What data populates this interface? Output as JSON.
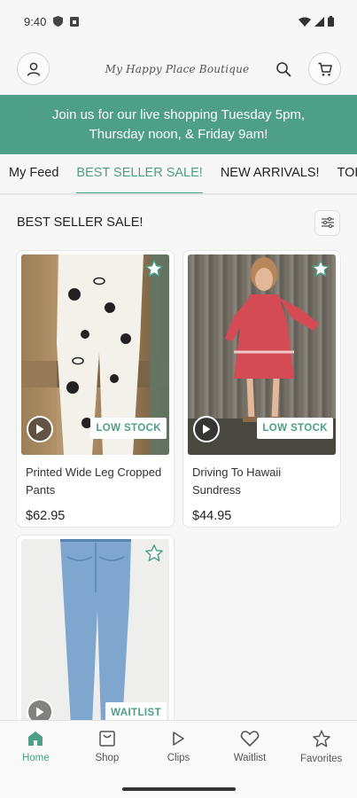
{
  "status": {
    "time": "9:40"
  },
  "header": {
    "brand": "My Happy Place Boutique"
  },
  "promo": {
    "text": "Join us for our live shopping Tuesday 5pm,\nThursday noon, & Friday 9am!"
  },
  "tabs": [
    {
      "label": "My Feed",
      "active": false
    },
    {
      "label": "BEST SELLER SALE!",
      "active": true
    },
    {
      "label": "NEW ARRIVALS!",
      "active": false
    },
    {
      "label": "TOPS",
      "active": false
    }
  ],
  "section": {
    "title": "BEST SELLER SALE!"
  },
  "products": [
    {
      "name": "Printed Wide Leg Cropped Pants",
      "price": "$62.95",
      "badge": "LOW STOCK",
      "image": "pants-photo"
    },
    {
      "name": "Driving To Hawaii Sundress",
      "price": "$44.95",
      "badge": "LOW STOCK",
      "image": "dress-photo"
    },
    {
      "name": "",
      "price": "",
      "badge": "WAITLIST",
      "image": "jeans-photo"
    }
  ],
  "nav": [
    {
      "label": "Home",
      "icon": "home-icon",
      "active": true
    },
    {
      "label": "Shop",
      "icon": "shop-icon",
      "active": false
    },
    {
      "label": "Clips",
      "icon": "play-icon",
      "active": false
    },
    {
      "label": "Waitlist",
      "icon": "heart-icon",
      "active": false
    },
    {
      "label": "Favorites",
      "icon": "star-icon",
      "active": false
    }
  ],
  "colors": {
    "accent": "#4d9f87",
    "background": "#f7f7f7"
  }
}
